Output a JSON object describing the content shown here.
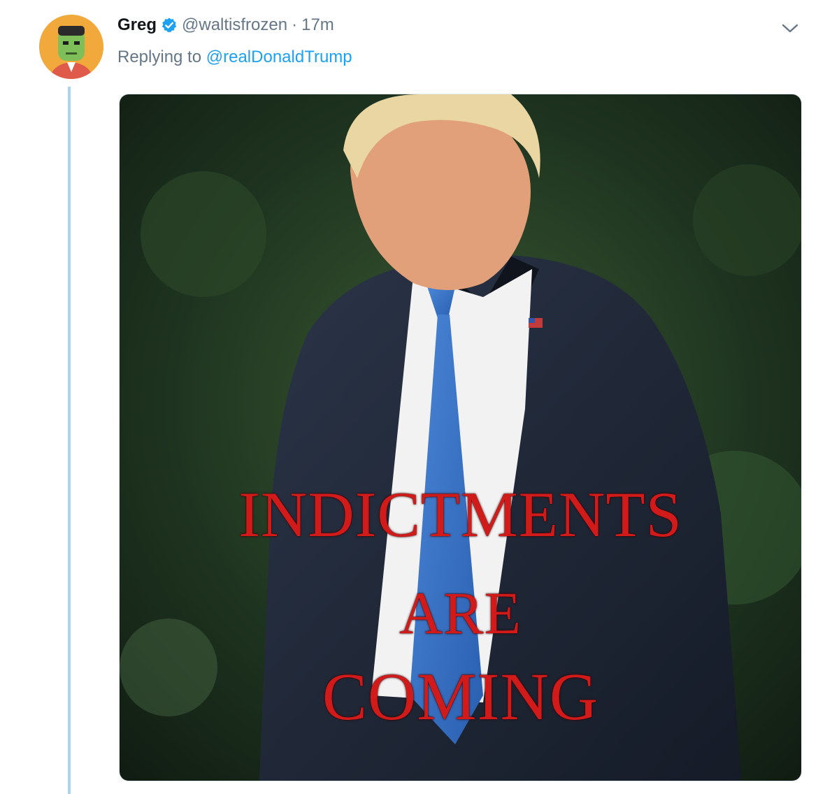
{
  "tweet": {
    "author": {
      "display_name": "Greg",
      "handle": "@waltisfrozen",
      "verified": true,
      "avatar_icon": "avatar-illustration"
    },
    "separator": "·",
    "timestamp": "17m",
    "reply": {
      "prefix": "Replying to",
      "mention": "@realDonaldTrump"
    },
    "menu_icon": "chevron-down-icon",
    "media": {
      "caption_lines": [
        "INDICTMENTS",
        "ARE",
        "COMING"
      ]
    }
  },
  "colors": {
    "accent": "#1da1f2",
    "thread_line": "#a9d3f3",
    "text_primary": "#14171a",
    "text_secondary": "#657786",
    "caption_red": "#d11b1b"
  }
}
